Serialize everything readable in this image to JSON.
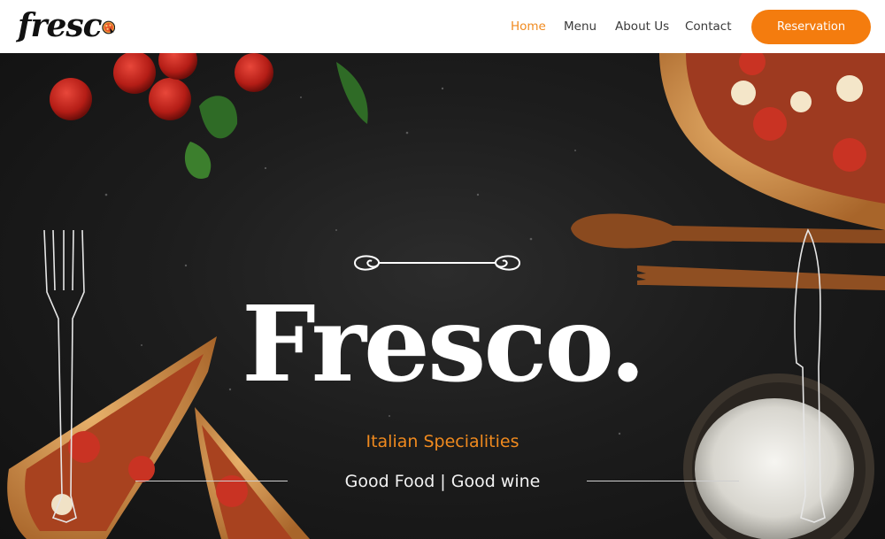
{
  "header": {
    "logo_text": "fresc",
    "nav": [
      {
        "label": "Home",
        "active": true
      },
      {
        "label": "Menu",
        "active": false
      },
      {
        "label": "About Us",
        "active": false
      },
      {
        "label": "Contact",
        "active": false
      }
    ],
    "reservation_label": "Reservation"
  },
  "hero": {
    "title": "Fresco.",
    "subtitle": "Italian Specialities",
    "tagline": "Good Food | Good wine"
  },
  "colors": {
    "accent": "#f47c0e",
    "accent_text": "#f08a1e",
    "hero_background": "#1d1d1d",
    "header_background": "#ffffff"
  },
  "icons": [
    "pizza-logo-icon",
    "ornament-divider",
    "fork-outline",
    "knife-outline"
  ]
}
